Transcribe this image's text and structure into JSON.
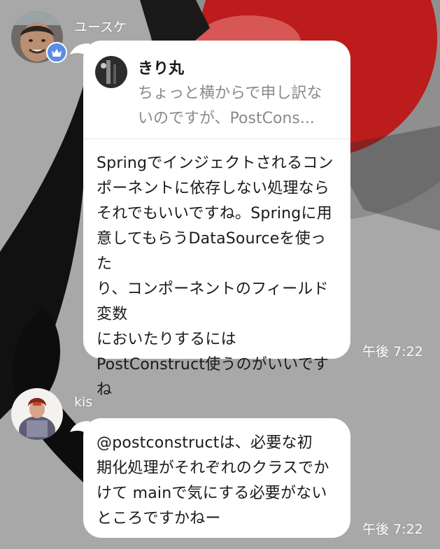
{
  "messages": [
    {
      "sender": "ユースケ",
      "avatar_icon": "user-avatar-photo",
      "badge_icon": "crown-icon",
      "reply": {
        "name": "きり丸",
        "preview": "ちょっと横からで申し訳な\nいのですが、PostCons..."
      },
      "text": "Springでインジェクトされるコン\nポーネントに依存しない処理なら\nそれでもいいですね。Springに用\n意してもらうDataSourceを使った\nり、コンポーネントのフィールド変数\nにおいたりするには\nPostConstruct使うのがいいです\nね",
      "time": "午後 7:22"
    },
    {
      "sender": "kis",
      "avatar_icon": "user-avatar-photo",
      "text": "@postconstructは、必要な初\n期化処理がそれぞれのクラスでか\nけて mainで気にする必要がない\nところですかねー",
      "time": "午後 7:22"
    }
  ],
  "colors": {
    "background": "#a9a9a9",
    "bubble": "#ffffff",
    "crown_badge": "#5b8ce8",
    "preview_text": "#8a8a8a"
  }
}
